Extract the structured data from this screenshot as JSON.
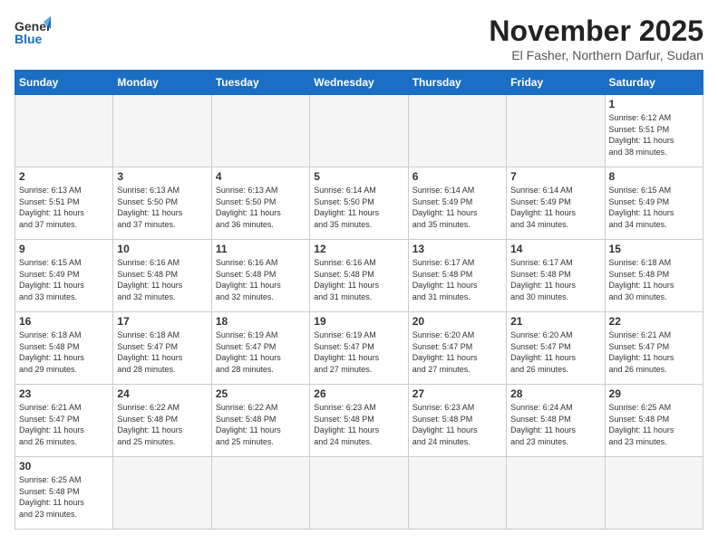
{
  "header": {
    "logo_line1": "General",
    "logo_line2": "Blue",
    "month": "November 2025",
    "location": "El Fasher, Northern Darfur, Sudan"
  },
  "weekdays": [
    "Sunday",
    "Monday",
    "Tuesday",
    "Wednesday",
    "Thursday",
    "Friday",
    "Saturday"
  ],
  "weeks": [
    [
      {
        "day": "",
        "info": ""
      },
      {
        "day": "",
        "info": ""
      },
      {
        "day": "",
        "info": ""
      },
      {
        "day": "",
        "info": ""
      },
      {
        "day": "",
        "info": ""
      },
      {
        "day": "",
        "info": ""
      },
      {
        "day": "1",
        "info": "Sunrise: 6:12 AM\nSunset: 5:51 PM\nDaylight: 11 hours\nand 38 minutes."
      }
    ],
    [
      {
        "day": "2",
        "info": "Sunrise: 6:13 AM\nSunset: 5:51 PM\nDaylight: 11 hours\nand 37 minutes."
      },
      {
        "day": "3",
        "info": "Sunrise: 6:13 AM\nSunset: 5:50 PM\nDaylight: 11 hours\nand 37 minutes."
      },
      {
        "day": "4",
        "info": "Sunrise: 6:13 AM\nSunset: 5:50 PM\nDaylight: 11 hours\nand 36 minutes."
      },
      {
        "day": "5",
        "info": "Sunrise: 6:14 AM\nSunset: 5:50 PM\nDaylight: 11 hours\nand 35 minutes."
      },
      {
        "day": "6",
        "info": "Sunrise: 6:14 AM\nSunset: 5:49 PM\nDaylight: 11 hours\nand 35 minutes."
      },
      {
        "day": "7",
        "info": "Sunrise: 6:14 AM\nSunset: 5:49 PM\nDaylight: 11 hours\nand 34 minutes."
      },
      {
        "day": "8",
        "info": "Sunrise: 6:15 AM\nSunset: 5:49 PM\nDaylight: 11 hours\nand 34 minutes."
      }
    ],
    [
      {
        "day": "9",
        "info": "Sunrise: 6:15 AM\nSunset: 5:49 PM\nDaylight: 11 hours\nand 33 minutes."
      },
      {
        "day": "10",
        "info": "Sunrise: 6:16 AM\nSunset: 5:48 PM\nDaylight: 11 hours\nand 32 minutes."
      },
      {
        "day": "11",
        "info": "Sunrise: 6:16 AM\nSunset: 5:48 PM\nDaylight: 11 hours\nand 32 minutes."
      },
      {
        "day": "12",
        "info": "Sunrise: 6:16 AM\nSunset: 5:48 PM\nDaylight: 11 hours\nand 31 minutes."
      },
      {
        "day": "13",
        "info": "Sunrise: 6:17 AM\nSunset: 5:48 PM\nDaylight: 11 hours\nand 31 minutes."
      },
      {
        "day": "14",
        "info": "Sunrise: 6:17 AM\nSunset: 5:48 PM\nDaylight: 11 hours\nand 30 minutes."
      },
      {
        "day": "15",
        "info": "Sunrise: 6:18 AM\nSunset: 5:48 PM\nDaylight: 11 hours\nand 30 minutes."
      }
    ],
    [
      {
        "day": "16",
        "info": "Sunrise: 6:18 AM\nSunset: 5:48 PM\nDaylight: 11 hours\nand 29 minutes."
      },
      {
        "day": "17",
        "info": "Sunrise: 6:18 AM\nSunset: 5:47 PM\nDaylight: 11 hours\nand 28 minutes."
      },
      {
        "day": "18",
        "info": "Sunrise: 6:19 AM\nSunset: 5:47 PM\nDaylight: 11 hours\nand 28 minutes."
      },
      {
        "day": "19",
        "info": "Sunrise: 6:19 AM\nSunset: 5:47 PM\nDaylight: 11 hours\nand 27 minutes."
      },
      {
        "day": "20",
        "info": "Sunrise: 6:20 AM\nSunset: 5:47 PM\nDaylight: 11 hours\nand 27 minutes."
      },
      {
        "day": "21",
        "info": "Sunrise: 6:20 AM\nSunset: 5:47 PM\nDaylight: 11 hours\nand 26 minutes."
      },
      {
        "day": "22",
        "info": "Sunrise: 6:21 AM\nSunset: 5:47 PM\nDaylight: 11 hours\nand 26 minutes."
      }
    ],
    [
      {
        "day": "23",
        "info": "Sunrise: 6:21 AM\nSunset: 5:47 PM\nDaylight: 11 hours\nand 26 minutes."
      },
      {
        "day": "24",
        "info": "Sunrise: 6:22 AM\nSunset: 5:48 PM\nDaylight: 11 hours\nand 25 minutes."
      },
      {
        "day": "25",
        "info": "Sunrise: 6:22 AM\nSunset: 5:48 PM\nDaylight: 11 hours\nand 25 minutes."
      },
      {
        "day": "26",
        "info": "Sunrise: 6:23 AM\nSunset: 5:48 PM\nDaylight: 11 hours\nand 24 minutes."
      },
      {
        "day": "27",
        "info": "Sunrise: 6:23 AM\nSunset: 5:48 PM\nDaylight: 11 hours\nand 24 minutes."
      },
      {
        "day": "28",
        "info": "Sunrise: 6:24 AM\nSunset: 5:48 PM\nDaylight: 11 hours\nand 23 minutes."
      },
      {
        "day": "29",
        "info": "Sunrise: 6:25 AM\nSunset: 5:48 PM\nDaylight: 11 hours\nand 23 minutes."
      }
    ],
    [
      {
        "day": "30",
        "info": "Sunrise: 6:25 AM\nSunset: 5:48 PM\nDaylight: 11 hours\nand 23 minutes."
      },
      {
        "day": "",
        "info": ""
      },
      {
        "day": "",
        "info": ""
      },
      {
        "day": "",
        "info": ""
      },
      {
        "day": "",
        "info": ""
      },
      {
        "day": "",
        "info": ""
      },
      {
        "day": "",
        "info": ""
      }
    ]
  ]
}
